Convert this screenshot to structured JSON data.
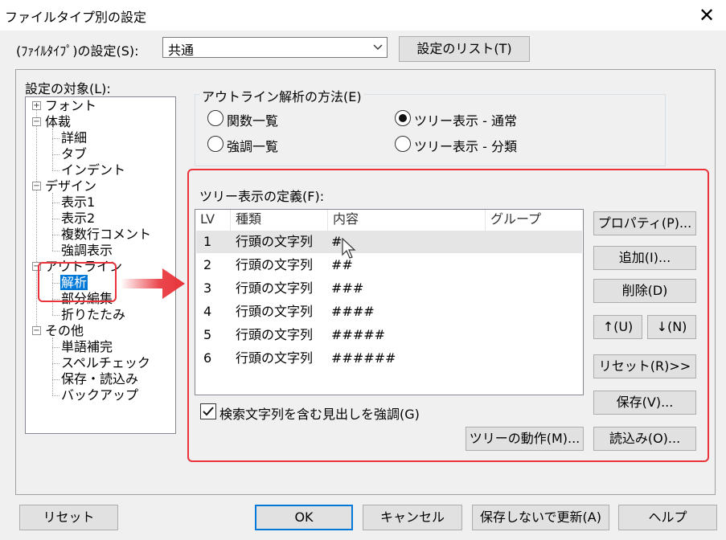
{
  "window": {
    "title": "ファイルタイプ別の設定"
  },
  "filetype": {
    "label": "(ﾌｧｲﾙﾀｲﾌﾟ)の設定(S):",
    "value": "共通",
    "list_button": "設定のリスト(T)"
  },
  "tree": {
    "label": "設定の対象(L):",
    "items": [
      {
        "label": "フォント"
      },
      {
        "label": "体裁"
      },
      {
        "label": "詳細"
      },
      {
        "label": "タブ"
      },
      {
        "label": "インデント"
      },
      {
        "label": "デザイン"
      },
      {
        "label": "表示1"
      },
      {
        "label": "表示2"
      },
      {
        "label": "複数行コメント"
      },
      {
        "label": "強調表示"
      },
      {
        "label": "アウトライン"
      },
      {
        "label": "解析"
      },
      {
        "label": "部分編集"
      },
      {
        "label": "折りたたみ"
      },
      {
        "label": "その他"
      },
      {
        "label": "単語補完"
      },
      {
        "label": "スペルチェック"
      },
      {
        "label": "保存・読込み"
      },
      {
        "label": "バックアップ"
      }
    ]
  },
  "outline_method": {
    "caption": "アウトライン解析の方法(E)",
    "options": [
      {
        "label": "関数一覧",
        "selected": false
      },
      {
        "label": "ツリー表示 - 通常",
        "selected": true
      },
      {
        "label": "強調一覧",
        "selected": false
      },
      {
        "label": "ツリー表示 - 分類",
        "selected": false
      }
    ]
  },
  "tree_def": {
    "label": "ツリー表示の定義(F):",
    "columns": [
      "LV",
      "種類",
      "内容",
      "グループ"
    ],
    "rows": [
      {
        "lv": "1",
        "type": "行頭の文字列",
        "content": "#",
        "group": ""
      },
      {
        "lv": "2",
        "type": "行頭の文字列",
        "content": "##",
        "group": ""
      },
      {
        "lv": "3",
        "type": "行頭の文字列",
        "content": "###",
        "group": ""
      },
      {
        "lv": "4",
        "type": "行頭の文字列",
        "content": "####",
        "group": ""
      },
      {
        "lv": "5",
        "type": "行頭の文字列",
        "content": "#####",
        "group": ""
      },
      {
        "lv": "6",
        "type": "行頭の文字列",
        "content": "######",
        "group": ""
      }
    ],
    "buttons": {
      "properties": "プロパティ(P)...",
      "add": "追加(I)...",
      "delete": "削除(D)",
      "up": "↑(U)",
      "down": "↓(N)",
      "reset": "リセット(R)>>",
      "save": "保存(V)...",
      "load": "読込み(O)...",
      "tree_action": "ツリーの動作(M)..."
    },
    "highlight_checkbox": {
      "label": "検索文字列を含む見出しを強調(G)",
      "checked": true
    }
  },
  "footer": {
    "reset": "リセット",
    "ok": "OK",
    "cancel": "キャンセル",
    "update_nosave": "保存しないで更新(A)",
    "help": "ヘルプ"
  },
  "colors": {
    "annotation_red": "#e8333a",
    "selection_blue": "#0078d7"
  }
}
